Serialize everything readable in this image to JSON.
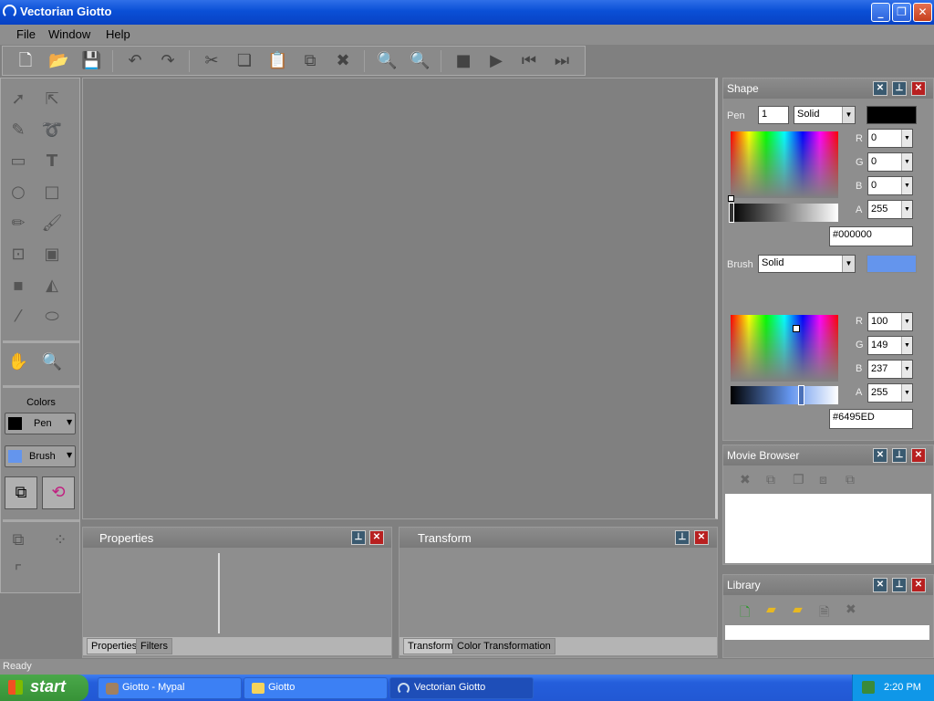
{
  "window": {
    "title": "Vectorian Giotto"
  },
  "menu": [
    "File",
    "Window",
    "Help"
  ],
  "colors_panel": {
    "title": "Colors",
    "pen_label": "Pen",
    "brush_label": "Brush",
    "pen_color": "#000000",
    "brush_color": "#6495ED"
  },
  "shape_panel": {
    "title": "Shape",
    "pen": {
      "label": "Pen",
      "width": "1",
      "style": "Solid",
      "r": "0",
      "g": "0",
      "b": "0",
      "a": "255",
      "hex": "#000000"
    },
    "brush": {
      "label": "Brush",
      "style": "Solid",
      "r": "100",
      "g": "149",
      "b": "237",
      "a": "255",
      "hex": "#6495ED"
    },
    "channel_labels": [
      "R",
      "G",
      "B",
      "A"
    ]
  },
  "movie_browser": {
    "title": "Movie Browser"
  },
  "library": {
    "title": "Library"
  },
  "properties_panel": {
    "title": "Properties",
    "tabs": [
      "Properties",
      "Filters"
    ]
  },
  "transform_panel": {
    "title": "Transform",
    "tabs": [
      "Transform",
      "Color Transformation"
    ]
  },
  "status": {
    "text": "Ready"
  },
  "taskbar": {
    "start": "start",
    "tasks": [
      "Giotto - Mypal",
      "Giotto",
      "Vectorian Giotto"
    ],
    "clock": "2:20 PM"
  }
}
